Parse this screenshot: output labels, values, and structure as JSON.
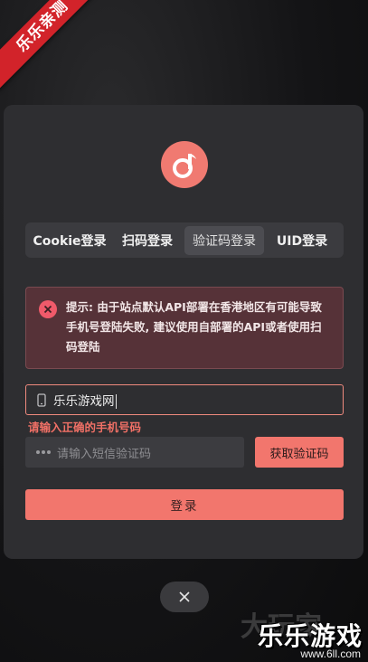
{
  "ribbon": {
    "text": "乐乐亲测"
  },
  "tabs": [
    {
      "label": "Cookie登录"
    },
    {
      "label": "扫码登录"
    },
    {
      "label": "验证码登录",
      "active": true
    },
    {
      "label": "UID登录"
    }
  ],
  "alert": {
    "text": "提示: 由于站点默认API部署在香港地区有可能导致手机号登陆失败, 建议使用自部署的API或者使用扫码登陆"
  },
  "phone": {
    "value": "乐乐游戏网"
  },
  "error": {
    "text": "请输入正确的手机号码"
  },
  "code": {
    "placeholder": "请输入短信验证码"
  },
  "buttons": {
    "get_code": "获取验证码",
    "login": "登录"
  },
  "watermark": {
    "ghost": "大玩家",
    "main": "乐乐游戏",
    "url": "www.6ll.com"
  },
  "colors": {
    "accent": "#f2766d",
    "panel": "#2e2e31",
    "alert_bg": "#563238",
    "error": "#f07066"
  },
  "icons": [
    "music-note-icon",
    "error-circle-icon",
    "phone-icon",
    "password-dots-icon",
    "close-icon"
  ]
}
